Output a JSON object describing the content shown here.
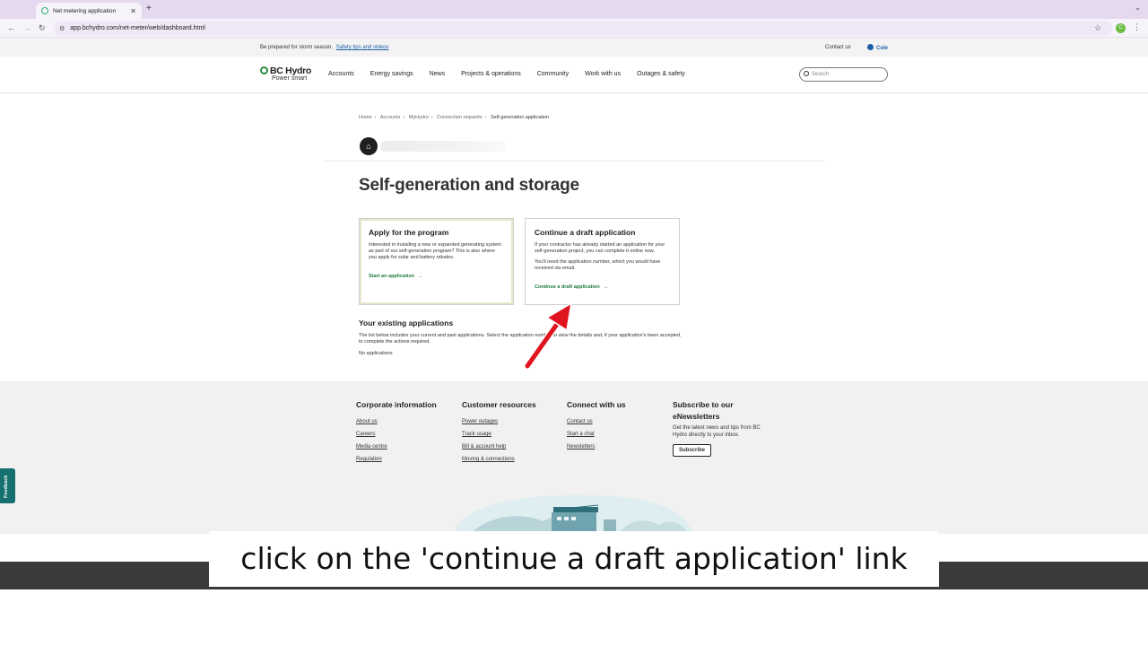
{
  "browser": {
    "tab_title": "Net metering application",
    "new_tab": "+",
    "url": "app.bchydro.com/net-meter/web/dashboard.html",
    "profile_initial": "C"
  },
  "alert": {
    "message": "Be prepared for storm season.",
    "link": "Safety tips and videos",
    "contact": "Contact us",
    "user": "Cole"
  },
  "header": {
    "logo": "BC Hydro",
    "tagline": "Power smart",
    "nav": [
      "Accounts",
      "Energy savings",
      "News",
      "Projects & operations",
      "Community",
      "Work with us",
      "Outages & safety"
    ],
    "search_placeholder": "Search"
  },
  "breadcrumb": [
    "Home",
    "Accounts",
    "MyHydro",
    "Connection requests",
    "Self-generation application"
  ],
  "page_title": "Self-generation and storage",
  "cards": {
    "apply": {
      "title": "Apply for the program",
      "body": "Interested in installing a new or expanded generating system as part of our self-generation program? This is also where you apply for solar and battery rebates.",
      "cta": "Start an application"
    },
    "draft": {
      "title": "Continue a draft application",
      "body1": "If your contractor has already started an application for your self-generation project, you can complete it online now.",
      "body2": "You'll need the application number, which you would have received via email.",
      "cta": "Continue a draft application"
    }
  },
  "existing": {
    "title": "Your existing applications",
    "body": "The list below includes your current and past applications. Select the application number to view the details and, if your application's been accepted, to complete the actions required.",
    "empty": "No applications"
  },
  "footer": {
    "corporate": {
      "title": "Corporate information",
      "links": [
        "About us",
        "Careers",
        "Media centre",
        "Regulation"
      ]
    },
    "customer": {
      "title": "Customer resources",
      "links": [
        "Power outages",
        "Track usage",
        "Bill & account help",
        "Moving & connections"
      ]
    },
    "connect": {
      "title": "Connect with us",
      "links": [
        "Contact us",
        "Start a chat",
        "Newsletters"
      ]
    },
    "subscribe": {
      "title": "Subscribe to our eNewsletters",
      "desc": "Get the latest news and tips from BC Hydro directly to your inbox.",
      "button": "Subscribe"
    }
  },
  "feedback": "Feedback",
  "caption": "click on the 'continue a draft application' link",
  "colors": {
    "accent_green": "#1e7a3a",
    "link_blue": "#1b5fa8",
    "arrow_red": "#e0141e",
    "feedback_teal": "#167070"
  }
}
